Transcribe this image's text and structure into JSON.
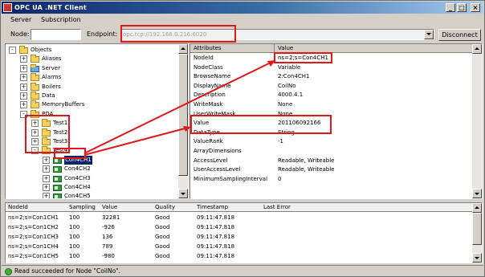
{
  "window": {
    "title": "OPC UA .NET Client"
  },
  "menu": [
    "Server",
    "Subscription"
  ],
  "toolbar": {
    "node_label": "Node:",
    "node_value": "",
    "endpoint_label": "Endpoint:",
    "endpoint_value": "opc.tcp://192.168.0.216:6020",
    "disconnect_label": "Disconnect"
  },
  "tree": [
    {
      "label": "Objects",
      "expander": "-",
      "icon": "folder"
    },
    {
      "label": "Aliases",
      "expander": "+",
      "icon": "folder"
    },
    {
      "label": "Server",
      "expander": "+",
      "icon": "server"
    },
    {
      "label": "Alarms",
      "expander": "+",
      "icon": "folder"
    },
    {
      "label": "Boilers",
      "expander": "+",
      "icon": "folder"
    },
    {
      "label": "Data",
      "expander": "+",
      "icon": "folder"
    },
    {
      "label": "MemoryBuffers",
      "expander": "+",
      "icon": "folder"
    },
    {
      "label": "PDA",
      "expander": "-",
      "icon": "folder"
    },
    {
      "label": "Test1",
      "expander": "+",
      "icon": "folder"
    },
    {
      "label": "Test2",
      "expander": "+",
      "icon": "folder"
    },
    {
      "label": "Test3",
      "expander": "+",
      "icon": "folder"
    },
    {
      "label": "Test4",
      "expander": "-",
      "icon": "folder"
    },
    {
      "label": "Con4CH1",
      "expander": "+",
      "icon": "variable",
      "selected": true
    },
    {
      "label": "Con4CH2",
      "expander": "+",
      "icon": "variable"
    },
    {
      "label": "Con4CH3",
      "expander": "+",
      "icon": "variable"
    },
    {
      "label": "Con4CH4",
      "expander": "+",
      "icon": "variable"
    },
    {
      "label": "Con4CH5",
      "expander": "+",
      "icon": "variable"
    }
  ],
  "attributes": {
    "headers": [
      "Attributes",
      "Value"
    ],
    "rows": [
      [
        "NodeId",
        "ns=2;s=Con4CH1"
      ],
      [
        "NodeClass",
        "Variable"
      ],
      [
        "BrowseName",
        "2:Con4CH1"
      ],
      [
        "DisplayName",
        "CoilNo"
      ],
      [
        "Description",
        "4000.4.1"
      ],
      [
        "WriteMask",
        "None"
      ],
      [
        "UserWriteMask",
        "None"
      ],
      [
        "Value",
        "201106092166"
      ],
      [
        "DataType",
        "String"
      ],
      [
        "ValueRank",
        "-1"
      ],
      [
        "ArrayDimensions",
        ""
      ],
      [
        "AccessLevel",
        "Readable, Writeable"
      ],
      [
        "UserAccessLevel",
        "Readable, Writeable"
      ],
      [
        "MinimumSamplingInterval",
        "0"
      ]
    ]
  },
  "monitored": {
    "headers": [
      "NodeId",
      "Sampling",
      "Value",
      "Quality",
      "Timestamp",
      "Last Error"
    ],
    "rows": [
      [
        "ns=2;s=Con1CH1",
        "100",
        "32281",
        "Good",
        "09:11:47.818",
        ""
      ],
      [
        "ns=2;s=Con1CH2",
        "100",
        "-926",
        "Good",
        "09:11:47.818",
        ""
      ],
      [
        "ns=2;s=Con1CH3",
        "100",
        "136",
        "Good",
        "09:11:47.818",
        ""
      ],
      [
        "ns=2;s=Con1CH4",
        "100",
        "789",
        "Good",
        "09:11:47.818",
        ""
      ],
      [
        "ns=2;s=Con1CH5",
        "100",
        "-980",
        "Good",
        "09:11:47.818",
        ""
      ]
    ]
  },
  "status": {
    "text": "Read succeeded for Node \"CoilNo\"."
  },
  "colors": {
    "title_start": "#0a246a",
    "title_end": "#a6caf0",
    "annotation": "#e01818",
    "selection": "#0a246a",
    "status_ok": "#3ab23a"
  }
}
